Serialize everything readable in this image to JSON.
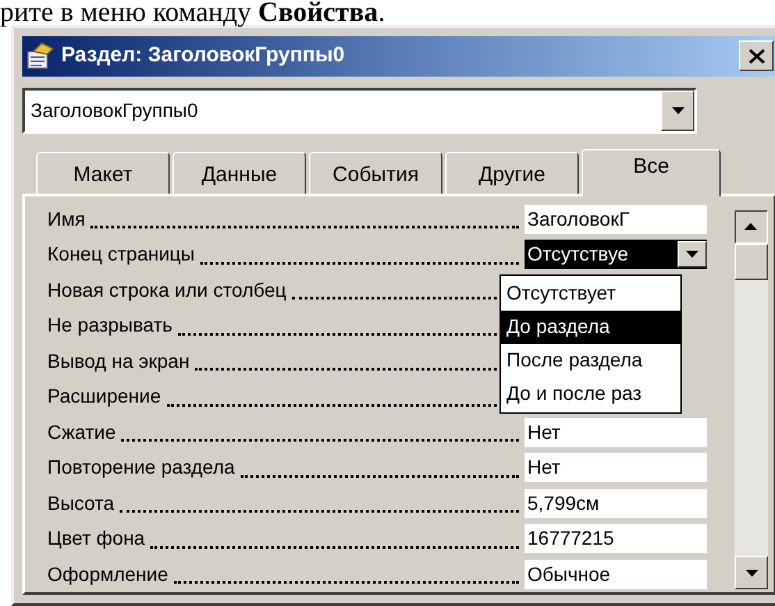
{
  "document_text": "рите в меню команду **Свойства**.",
  "window": {
    "title": "Раздел: ЗаголовокГруппы0"
  },
  "object_selector": {
    "value": "ЗаголовокГруппы0"
  },
  "tabs": [
    {
      "label": "Макет",
      "selected": false
    },
    {
      "label": "Данные",
      "selected": false
    },
    {
      "label": "События",
      "selected": false
    },
    {
      "label": "Другие",
      "selected": false
    },
    {
      "label": "Все",
      "selected": true
    }
  ],
  "properties": [
    {
      "name": "Имя",
      "value": "ЗаголовокГ",
      "focused": false
    },
    {
      "name": "Конец страницы",
      "value": "Отсутствуе",
      "focused": true
    },
    {
      "name": "Новая строка или столбец",
      "focused": false
    },
    {
      "name": "Не разрывать",
      "focused": false
    },
    {
      "name": "Вывод на экран",
      "focused": false
    },
    {
      "name": "Расширение",
      "focused": false
    },
    {
      "name": "Сжатие",
      "value": "Нет",
      "focused": false
    },
    {
      "name": "Повторение раздела",
      "value": "Нет",
      "focused": false
    },
    {
      "name": "Высота",
      "value": "5,799см",
      "focused": false
    },
    {
      "name": "Цвет фона",
      "value": "16777215",
      "focused": false
    },
    {
      "name": "Оформление",
      "value": "Обычное",
      "focused": false
    }
  ],
  "dropdown": {
    "items": [
      {
        "label": "Отсутствует",
        "selected": false
      },
      {
        "label": "До раздела",
        "selected": true
      },
      {
        "label": "После раздела",
        "selected": false
      },
      {
        "label": "До и после раз",
        "selected": false
      }
    ]
  }
}
